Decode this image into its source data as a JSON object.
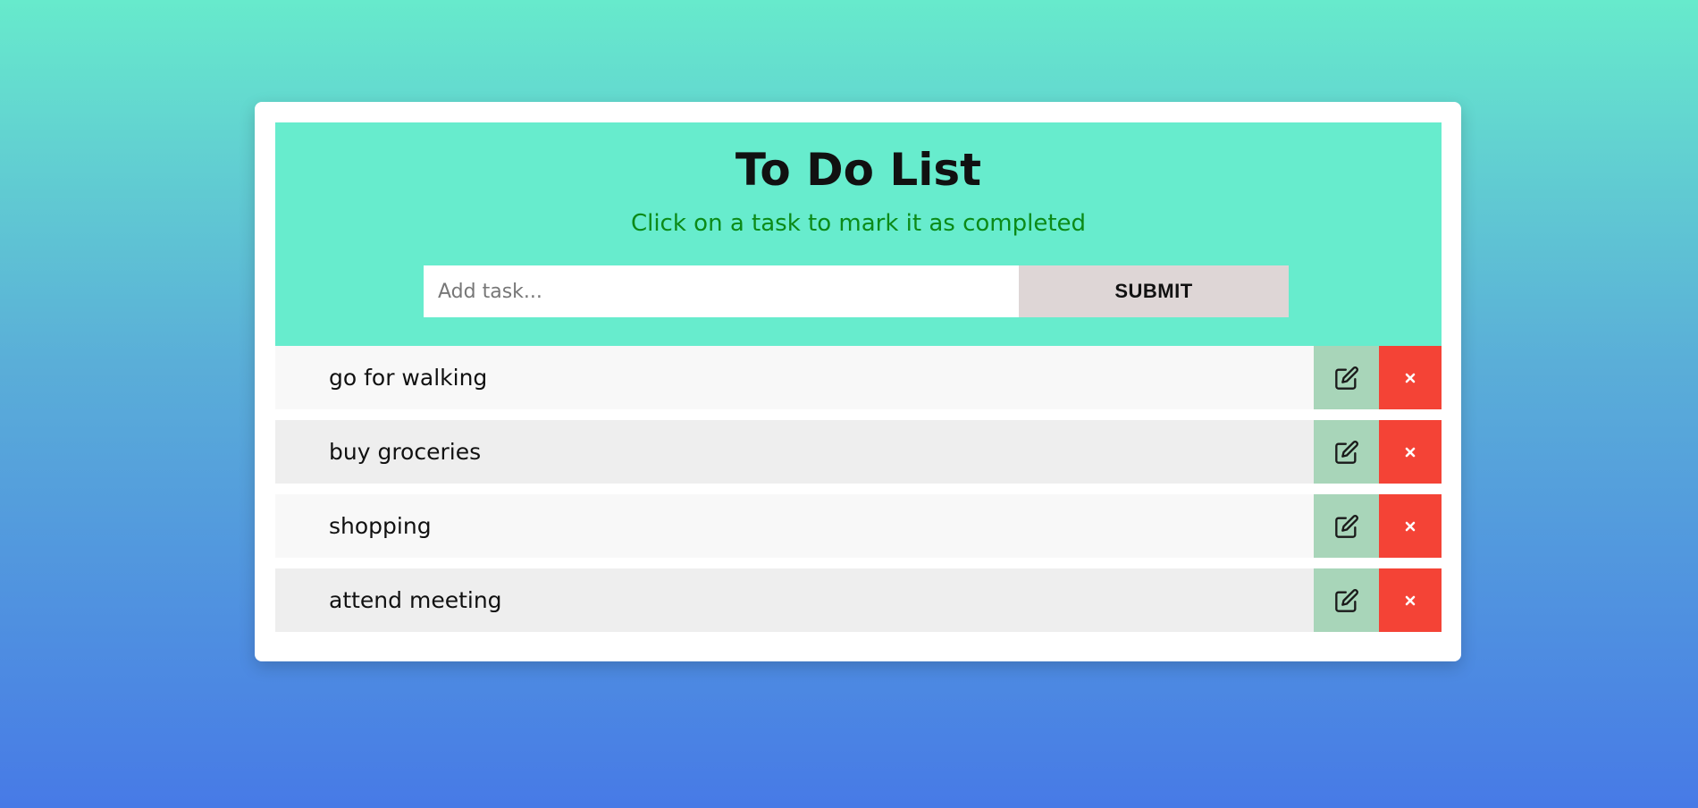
{
  "header": {
    "title": "To Do List",
    "subtitle": "Click on a task to mark it as completed"
  },
  "form": {
    "input_placeholder": "Add task...",
    "input_value": "",
    "submit_label": "SUBMIT"
  },
  "tasks": [
    {
      "label": "go for walking",
      "edit_icon": "edit-icon",
      "delete_icon": "close-icon"
    },
    {
      "label": "buy groceries",
      "edit_icon": "edit-icon",
      "delete_icon": "close-icon"
    },
    {
      "label": "shopping",
      "edit_icon": "edit-icon",
      "delete_icon": "close-icon"
    },
    {
      "label": "attend meeting",
      "edit_icon": "edit-icon",
      "delete_icon": "close-icon"
    }
  ],
  "colors": {
    "header_bg": "#67eccd",
    "subtitle": "#0b8a17",
    "submit_bg": "#ded6d6",
    "edit_bg": "#a8d5b9",
    "delete_bg": "#f44336",
    "row_odd": "#f8f8f8",
    "row_even": "#eeeeee"
  }
}
